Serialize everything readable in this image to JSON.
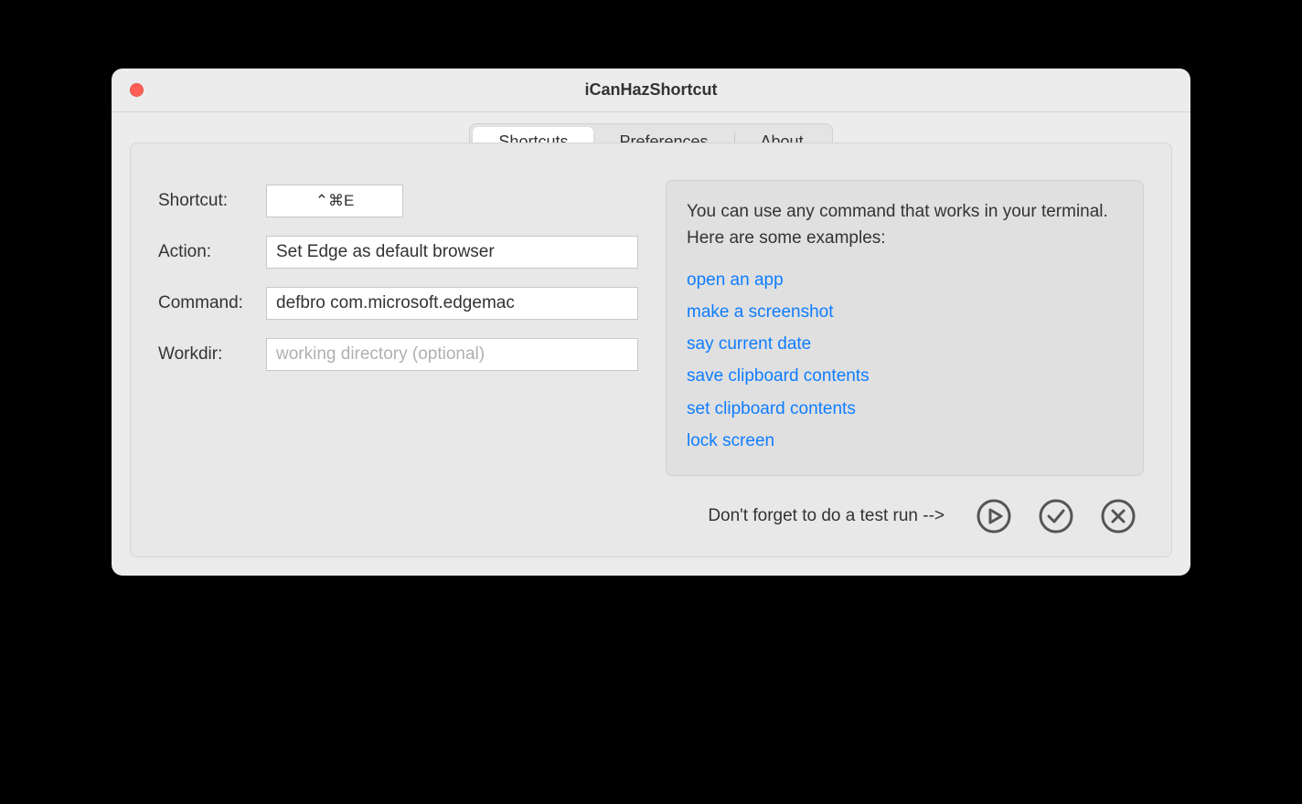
{
  "window": {
    "title": "iCanHazShortcut"
  },
  "tabs": {
    "shortcuts": "Shortcuts",
    "preferences": "Preferences",
    "about": "About"
  },
  "form": {
    "shortcut_label": "Shortcut:",
    "shortcut_value": "⌃⌘E",
    "action_label": "Action:",
    "action_value": "Set Edge as default browser",
    "command_label": "Command:",
    "command_value": "defbro com.microsoft.edgemac",
    "workdir_label": "Workdir:",
    "workdir_value": "",
    "workdir_placeholder": "working directory (optional)"
  },
  "hints": {
    "intro": "You can use any command that works in your terminal. Here are some examples:",
    "examples": {
      "open_app": "open an app",
      "screenshot": "make a screenshot",
      "say_date": "say current date",
      "save_clipboard": "save clipboard contents",
      "set_clipboard": "set clipboard contents",
      "lock_screen": "lock screen"
    }
  },
  "footer": {
    "hint": "Don't forget to do a test run -->"
  }
}
